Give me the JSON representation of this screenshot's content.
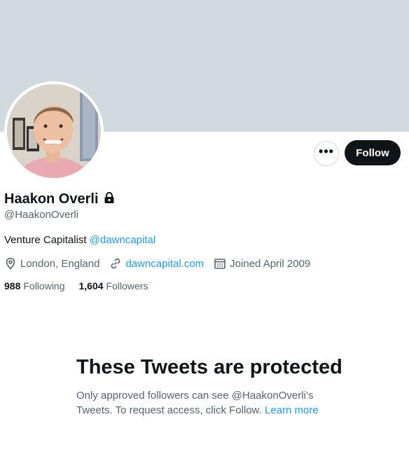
{
  "profile": {
    "display_name": "Haakon Overli",
    "handle": "@HaakonOverli",
    "bio_text": "Venture Capitalist ",
    "bio_mention": "@dawncapital",
    "location": "London, England",
    "website": "dawncapital.com",
    "joined": "Joined April 2009",
    "following_count": "988",
    "following_label": "Following",
    "followers_count": "1,604",
    "followers_label": "Followers"
  },
  "actions": {
    "more_label": "•••",
    "follow_label": "Follow"
  },
  "protected": {
    "title": "These Tweets are protected",
    "body": "Only approved followers can see @HaakonOverli’s Tweets. To request access, click Follow. ",
    "learn_more": "Learn more"
  },
  "icons": {
    "lock": "lock-icon",
    "location": "location-pin-icon",
    "link": "link-icon",
    "calendar": "calendar-icon",
    "more": "more-horizontal-icon"
  },
  "colors": {
    "banner": "#cfd9de",
    "link": "#1d9bf0",
    "primary_text": "#0f1419",
    "secondary_text": "#536471",
    "follow_button": "#0f1419"
  }
}
